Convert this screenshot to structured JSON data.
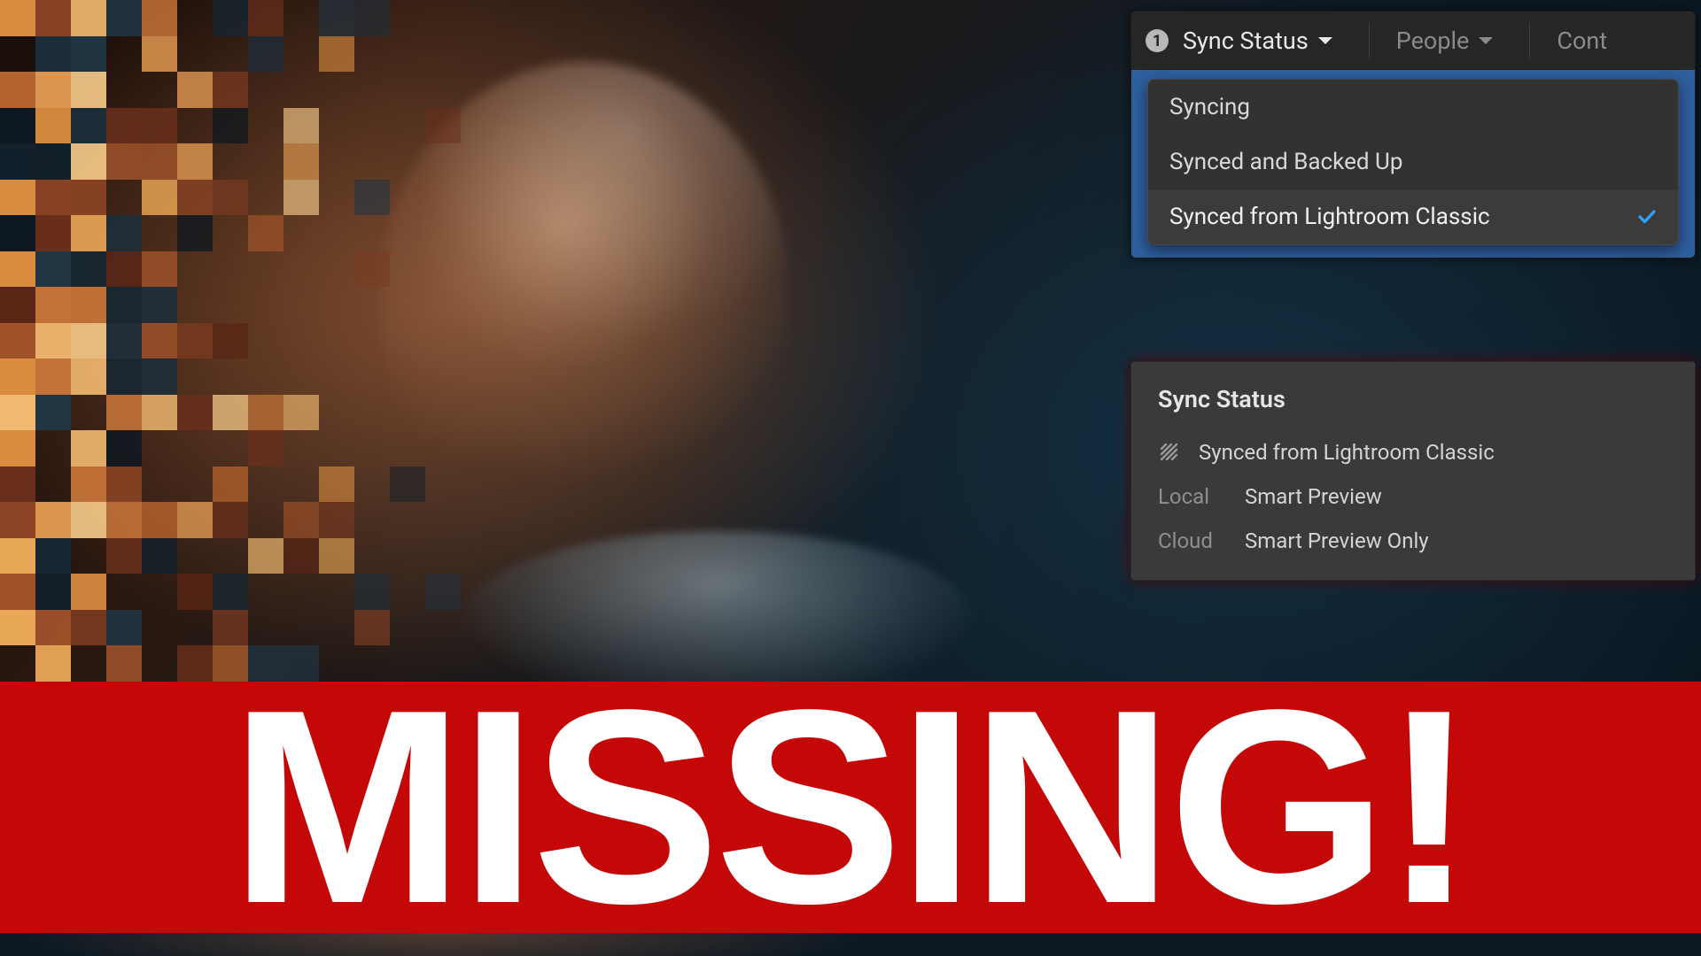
{
  "filterbar": {
    "badge_count": "1",
    "sync_status_label": "Sync Status",
    "people_label": "People",
    "contributed_label": "Cont",
    "dropdown": {
      "syncing": "Syncing",
      "synced_backed_up": "Synced and Backed Up",
      "synced_lr_classic": "Synced from Lightroom Classic"
    }
  },
  "info_panel": {
    "title": "Sync Status",
    "status_value": "Synced from Lightroom Classic",
    "local_label": "Local",
    "local_value": "Smart Preview",
    "cloud_label": "Cloud",
    "cloud_value": "Smart Preview Only"
  },
  "banner": {
    "text": "MISSING!"
  },
  "colors": {
    "banner_red": "#c40808",
    "accent_blue": "#2aa3ff",
    "selection_blue": "#2e5f9e"
  }
}
